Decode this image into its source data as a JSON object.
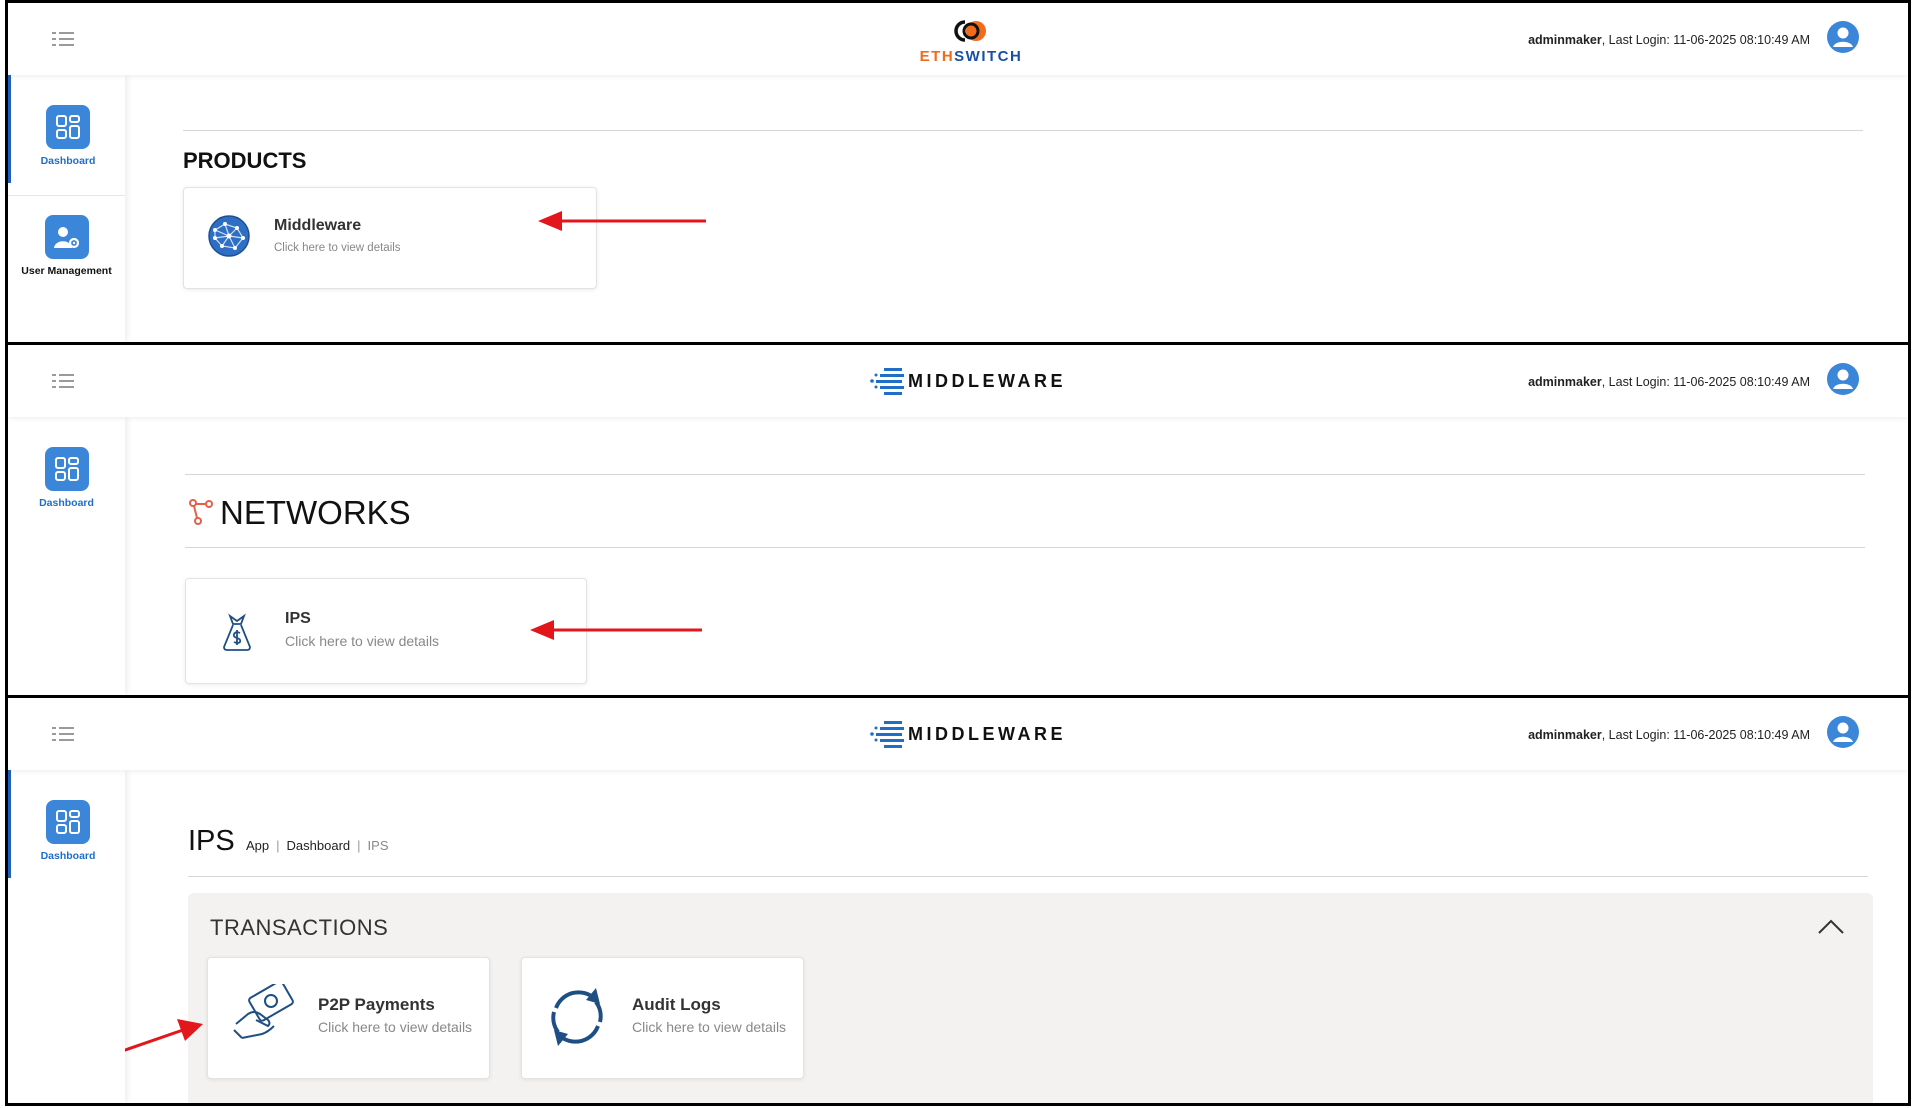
{
  "user": {
    "username": "adminmaker",
    "last_login_text": ", Last Login: 11-06-2025 08:10:49 AM"
  },
  "colors": {
    "accent": "#3b86d9",
    "eth_orange": "#f26a1b",
    "eth_blue": "#1a4fa3",
    "arrow_red": "#e3161c",
    "icon_blue": "#1e4f84"
  },
  "panel1": {
    "logo_eth": "ETH",
    "logo_switch": "SWITCH",
    "sidebar": {
      "items": [
        {
          "label": "Dashboard",
          "icon": "dashboard-icon"
        },
        {
          "label": "User Management",
          "icon": "user-gear-icon"
        }
      ]
    },
    "section_title": "PRODUCTS",
    "card": {
      "title": "Middleware",
      "subtitle": "Click here to view details",
      "icon": "globe-network-icon"
    }
  },
  "panel2": {
    "logo_text": "MIDDLEWARE",
    "sidebar": {
      "items": [
        {
          "label": "Dashboard",
          "icon": "dashboard-icon"
        }
      ]
    },
    "section_title": "NETWORKS",
    "card": {
      "title": "IPS",
      "subtitle": "Click here to view details",
      "icon": "money-bag-icon"
    }
  },
  "panel3": {
    "logo_text": "MIDDLEWARE",
    "sidebar": {
      "items": [
        {
          "label": "Dashboard",
          "icon": "dashboard-icon"
        }
      ]
    },
    "page_title": "IPS",
    "breadcrumb": [
      "App",
      "Dashboard",
      "IPS"
    ],
    "transactions_title": "TRANSACTIONS",
    "cards": [
      {
        "title": "P2P Payments",
        "subtitle": "Click here to view details",
        "icon": "hand-money-icon"
      },
      {
        "title": "Audit Logs",
        "subtitle": "Click here to view details",
        "icon": "refresh-icon"
      }
    ]
  }
}
